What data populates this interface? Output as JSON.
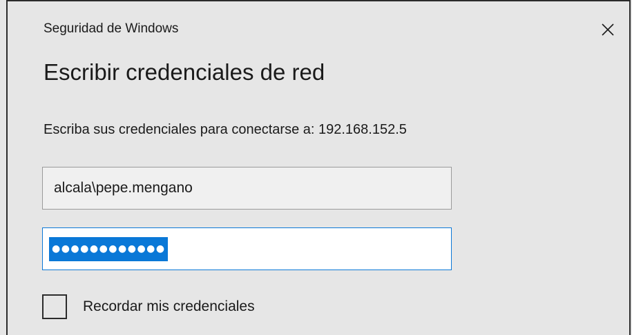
{
  "window": {
    "title": "Seguridad de Windows",
    "close_icon": "close-icon"
  },
  "dialog": {
    "heading": "Escribir credenciales de red",
    "description": "Escriba sus credenciales para conectarse a: 192.168.152.5"
  },
  "form": {
    "username_value": "alcala\\pepe.mengano",
    "password_value": "●●●●●●●●●●●●",
    "remember_label": "Recordar mis credenciales",
    "remember_checked": false
  },
  "colors": {
    "background": "#e6e6e6",
    "accent": "#0a78d7",
    "text": "#1a1a1a"
  }
}
